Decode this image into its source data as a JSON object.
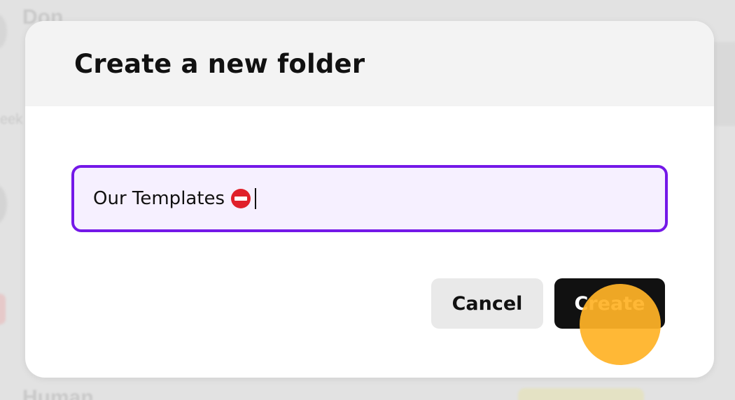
{
  "background": {
    "top_heading": "Don",
    "bottom_heading": "Human",
    "side_fragment": "eek"
  },
  "dialog": {
    "title": "Create a new folder",
    "folder_name_value": "Our Templates",
    "folder_name_icon": "no-entry-icon",
    "cancel_label": "Cancel",
    "create_label": "Create"
  },
  "colors": {
    "input_border": "#7418e8",
    "input_background": "#f6f0ff",
    "create_button_bg": "#111111",
    "cancel_button_bg": "#e9e9e9",
    "click_indicator": "#ffb327"
  }
}
